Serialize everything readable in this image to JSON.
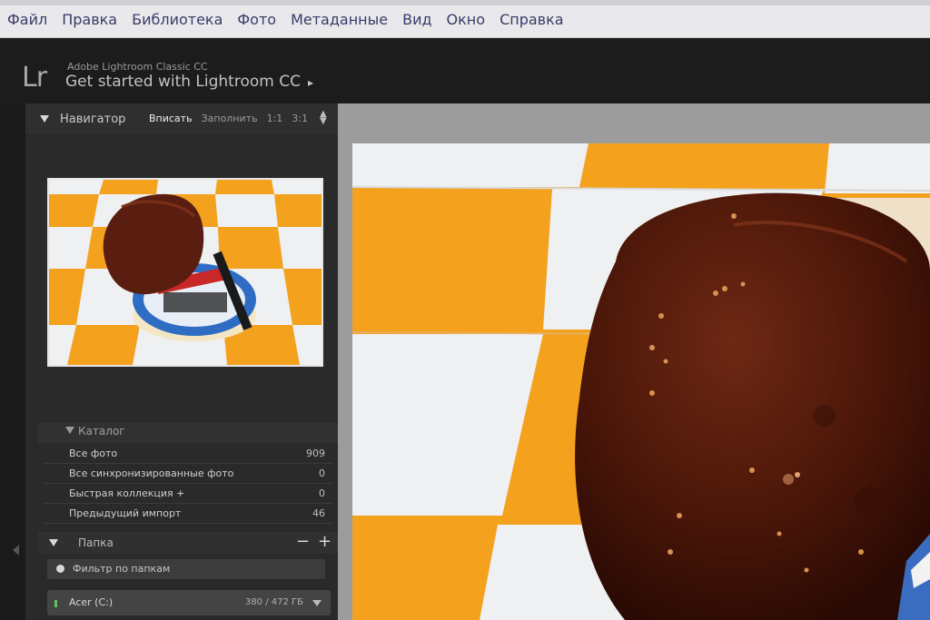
{
  "menubar": {
    "items": [
      "Файл",
      "Правка",
      "Библиотека",
      "Фото",
      "Метаданные",
      "Вид",
      "Окно",
      "Справка"
    ]
  },
  "identity": {
    "logo": "Lr",
    "subtitle": "Adobe Lightroom Classic CC",
    "title": "Get started with Lightroom CC",
    "arrow": "▸"
  },
  "navigator": {
    "title": "Навигатор",
    "zoom_options": [
      "Вписать",
      "Заполнить",
      "1:1",
      "3:1"
    ],
    "active_zoom": "Вписать"
  },
  "catalog": {
    "title": "Каталог",
    "rows": [
      {
        "label": "Все фото",
        "count": "909"
      },
      {
        "label": "Все синхронизированные фото",
        "count": "0"
      },
      {
        "label": "Быстрая коллекция +",
        "count": "0"
      },
      {
        "label": "Предыдущий импорт",
        "count": "46"
      }
    ]
  },
  "folders": {
    "title": "Папка",
    "minus": "−",
    "plus": "+",
    "filter_placeholder": "Фильтр по папкам",
    "drive_name": "Acer (C:)",
    "drive_size": "380 / 472 ГБ"
  },
  "colors": {
    "tile_orange": "#f4a11e",
    "tile_white": "#eef0f2",
    "bread": "#5a1e10",
    "panel": "#2a2a2a"
  }
}
